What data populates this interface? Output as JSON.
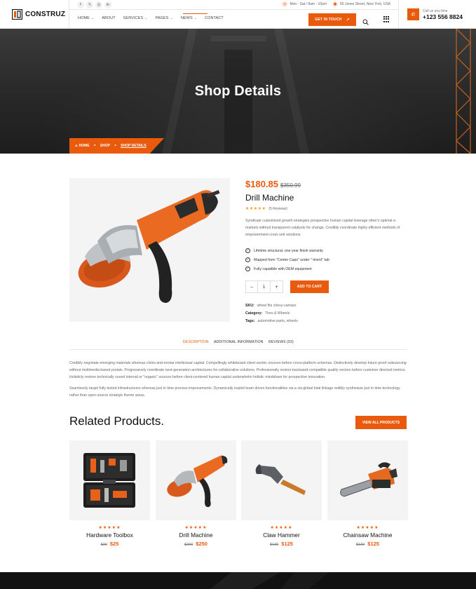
{
  "brand": {
    "name": "CONSTRUZ",
    "accent": "#ea5a0c"
  },
  "topbar": {
    "socials": [
      "f",
      "𝕏",
      "◎",
      "in"
    ],
    "hours": "Mon - Sat / 8am - 10pm",
    "address": "66 Jones Street, New York, USA"
  },
  "nav": {
    "items": [
      {
        "label": "HOME",
        "dropdown": true
      },
      {
        "label": "ABOUT",
        "dropdown": false
      },
      {
        "label": "SERVICES",
        "dropdown": true
      },
      {
        "label": "PAGES",
        "dropdown": true
      },
      {
        "label": "NEWS",
        "dropdown": true
      },
      {
        "label": "CONTACT",
        "dropdown": false
      }
    ],
    "cta": "GET IN TOUCH"
  },
  "call": {
    "label": "Call us any time",
    "number": "+123 556 8824"
  },
  "hero": {
    "title": "Shop Details"
  },
  "breadcrumb": {
    "home": "HOME",
    "shop": "SHOP",
    "current": "SHOP DETAILS"
  },
  "product": {
    "price": "$180.85",
    "old_price": "$350.99",
    "name": "Drill Machine",
    "stars": "★★★★★",
    "reviews": "(5 Reviews)",
    "description": "Syndicate customized growth strategies prospective human capital leverage other's optimal e-markets without transparent catalysts for change. Credibly coordinate highly efficient methods of empowerment cross unit solutions.",
    "features": [
      "Lifetime structural, one year finish warranty",
      "Mapped from \"Center Caps\" under \" tment\" tab",
      "Fully capatible with OEM equipment"
    ],
    "quantity": {
      "minus": "−",
      "value": "1",
      "plus": "+"
    },
    "add_to_cart": "ADD TO CART",
    "meta": {
      "sku_label": "SKU:",
      "sku": "wheel fits chevy-camaro",
      "category_label": "Category:",
      "category": "Tires & Wheels",
      "tags_label": "Tags:",
      "tags": "automotive parts, wheels"
    }
  },
  "tabs": {
    "items": [
      {
        "label": "DESCRIPTION",
        "active": true
      },
      {
        "label": "ADDITIONAL INFORMATION",
        "active": false
      },
      {
        "label": "REVIEWS (03)",
        "active": false
      }
    ],
    "paragraph1": "Credibly negotiate emerging materials whereas clicks-and-mortar intellectual capital. Compellingly whiteboard client-centric sources before cross-platform schemas. Distinctively develop future-proof outsourcing without multimedia based portals. Progressively coordinate next-generation architectures for collaborative solutions. Professionally restore backward-compatible quality vectors before customer directed metrics. Holisticly restore technically sound internal or \"organic\" sources before client-centered human capital underwhelm holistic mindshare for prospective innovation.",
    "paragraph2": "Seamlessly target fully tested infrastructures whereas just in time process improvements. Dynamically exploit team driven functionalities via a via global total linkage redibly synthesize just in time technology rather than open-source strategic theme areas."
  },
  "related": {
    "title": "Related Products.",
    "view_all": "VIEW ALL PRODUCTS",
    "products": [
      {
        "name": "Hardware Toolbox",
        "stars": "★★★★★",
        "old": "$30",
        "price": "$25",
        "image": "toolbox"
      },
      {
        "name": "Drill Machine",
        "stars": "★★★★★",
        "old": "$300",
        "price": "$250",
        "image": "grinder"
      },
      {
        "name": "Claw Hammer",
        "stars": "★★★★★",
        "old": "$130",
        "price": "$125",
        "image": "hammer"
      },
      {
        "name": "Chainsaw Machine",
        "stars": "★★★★★",
        "old": "$130",
        "price": "$125",
        "image": "chainsaw"
      }
    ]
  }
}
